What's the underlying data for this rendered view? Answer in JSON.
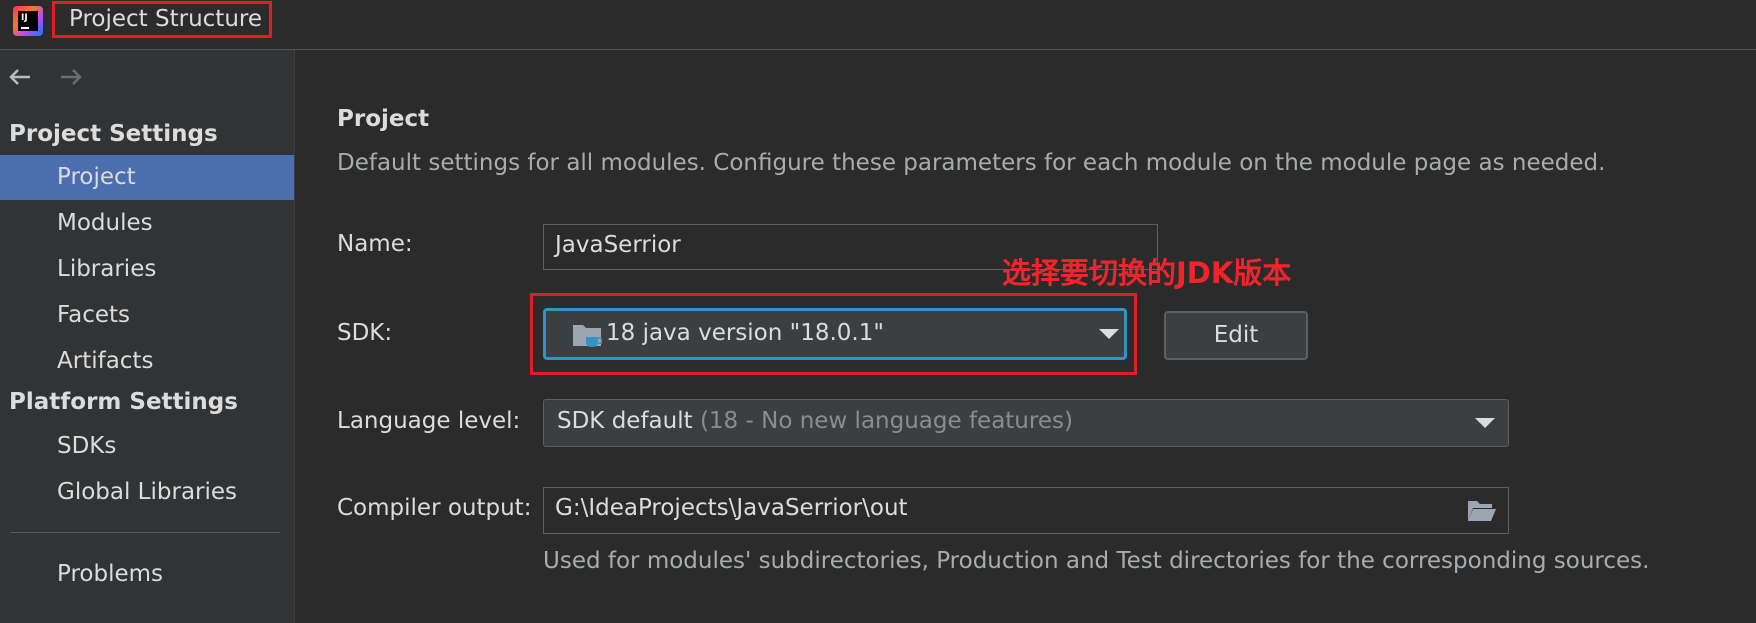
{
  "window": {
    "title": "Project Structure",
    "logo_icon": "intellij-idea-logo"
  },
  "sidebar": {
    "back_icon": "arrow-left-icon",
    "forward_icon": "arrow-right-icon",
    "project_settings_title": "Project Settings",
    "project_items": [
      {
        "label": "Project",
        "selected": true
      },
      {
        "label": "Modules",
        "selected": false
      },
      {
        "label": "Libraries",
        "selected": false
      },
      {
        "label": "Facets",
        "selected": false
      },
      {
        "label": "Artifacts",
        "selected": false
      }
    ],
    "platform_settings_title": "Platform Settings",
    "platform_items": [
      {
        "label": "SDKs"
      },
      {
        "label": "Global Libraries"
      }
    ],
    "problems_label": "Problems"
  },
  "main": {
    "heading": "Project",
    "description": "Default settings for all modules. Configure these parameters for each module on the module page as needed.",
    "name_label": "Name:",
    "name_value": "JavaSerrior",
    "sdk_label": "SDK:",
    "sdk_value": "18 java version \"18.0.1\"",
    "sdk_icon": "jdk-folder-icon",
    "edit_label": "Edit",
    "language_level_label": "Language level:",
    "language_level_value": "SDK default",
    "language_level_hint": "(18 - No new language features)",
    "compiler_output_label": "Compiler output:",
    "compiler_output_value": "G:\\IdeaProjects\\JavaSerrior\\out",
    "browse_icon": "open-folder-icon",
    "compiler_output_help": "Used for modules' subdirectories, Production and Test directories for the corresponding sources.",
    "annotation": "选择要切换的JDK版本"
  },
  "colors": {
    "background": "#2b2b2b",
    "sidebar": "#313335",
    "selection": "#4b6eaf",
    "focus_border": "#3592c4",
    "annotation_red": "#f0252b"
  }
}
